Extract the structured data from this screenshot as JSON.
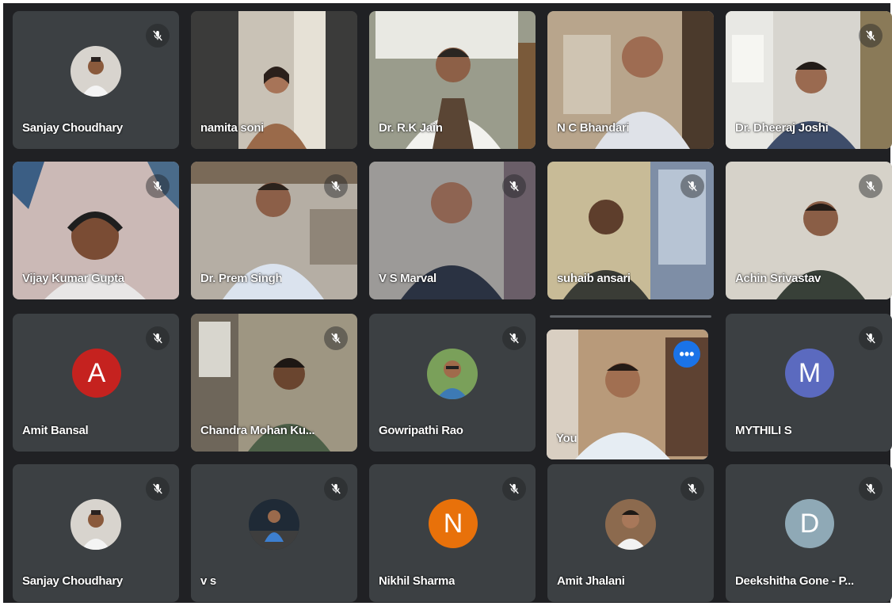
{
  "colors": {
    "background": "#202124",
    "tile": "#3c4043",
    "self_border": "#8ab4f8",
    "more_button": "#1a73e8",
    "avatar_amit_bansal": "#c5221f",
    "avatar_mythili": "#5b6abf",
    "avatar_nikhil": "#e8710a",
    "avatar_deekshitha": "#8fa9b6"
  },
  "participants": [
    {
      "name": "Sanjay Choudhary",
      "type": "photo-avatar",
      "muted": true
    },
    {
      "name": "namita soni",
      "type": "video",
      "muted": false
    },
    {
      "name": "Dr. R.K Jain",
      "type": "video",
      "muted": false
    },
    {
      "name": "N C Bhandari",
      "type": "video",
      "muted": false
    },
    {
      "name": "Dr. Dheeraj Joshi",
      "type": "video",
      "muted": true
    },
    {
      "name": "Vijay Kumar Gupta",
      "type": "video",
      "muted": true
    },
    {
      "name": "Dr. Prem Singh",
      "type": "video",
      "muted": true
    },
    {
      "name": "V S Marval",
      "type": "video",
      "muted": true
    },
    {
      "name": "suhaib ansari",
      "type": "video",
      "muted": true
    },
    {
      "name": "Achin Srivastav",
      "type": "video",
      "muted": true
    },
    {
      "name": "Amit Bansal",
      "type": "letter-avatar",
      "letter": "A",
      "muted": true
    },
    {
      "name": "Chandra Mohan Ku...",
      "type": "video",
      "muted": true
    },
    {
      "name": "Gowripathi Rao",
      "type": "photo-avatar",
      "muted": true
    },
    {
      "name": "You",
      "type": "video-self",
      "muted": false,
      "more_icon": "more-horiz-icon"
    },
    {
      "name": "MYTHILI S",
      "type": "letter-avatar",
      "letter": "M",
      "muted": true
    },
    {
      "name": "Sanjay Choudhary",
      "type": "photo-avatar",
      "muted": true
    },
    {
      "name": "v s",
      "type": "photo-avatar",
      "muted": true
    },
    {
      "name": "Nikhil Sharma",
      "type": "letter-avatar",
      "letter": "N",
      "muted": true
    },
    {
      "name": "Amit Jhalani",
      "type": "photo-avatar",
      "muted": true
    },
    {
      "name": "Deekshitha Gone - P...",
      "type": "letter-avatar",
      "letter": "D",
      "muted": true
    }
  ],
  "icons": {
    "mic_off": "mic-off-icon",
    "more": "more-horiz-icon"
  }
}
